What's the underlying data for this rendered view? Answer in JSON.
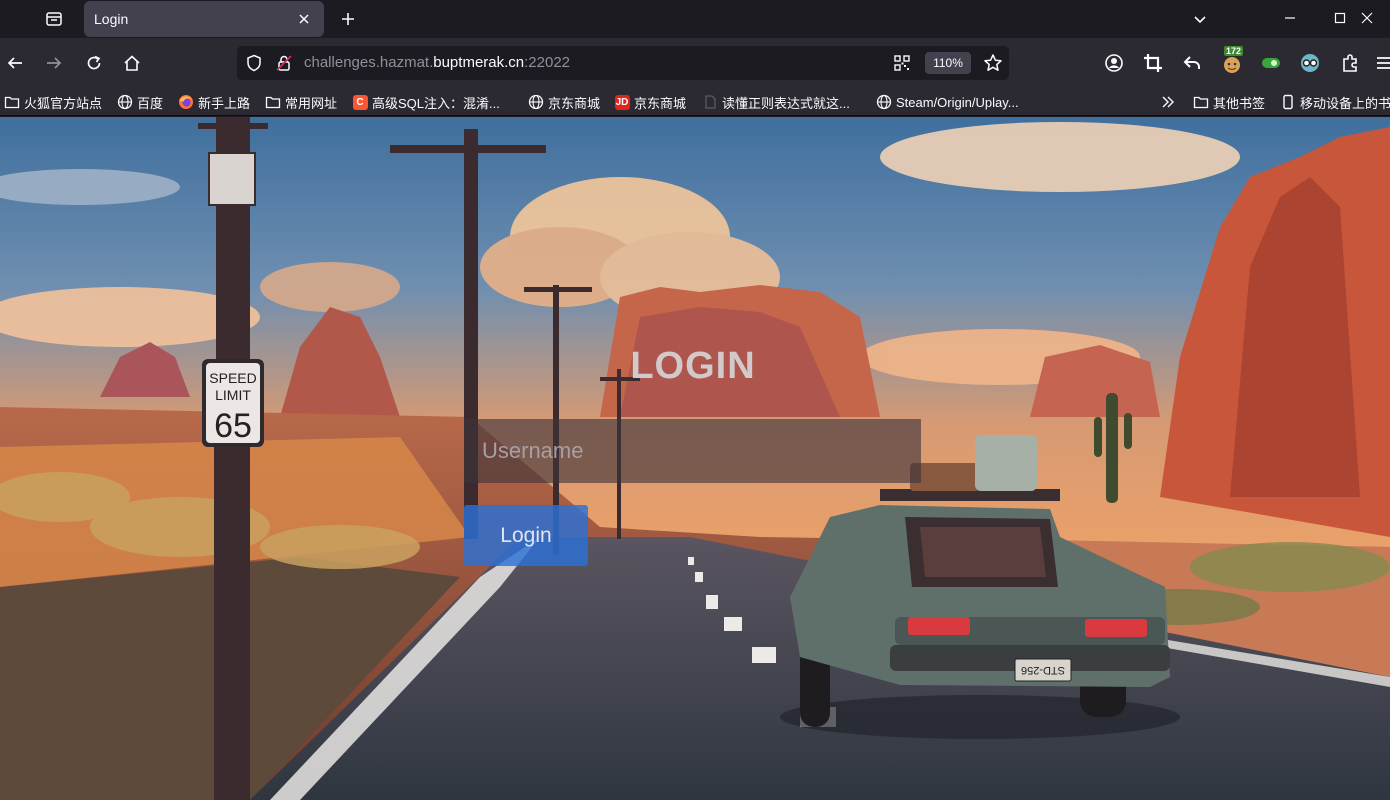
{
  "browser": {
    "tab": {
      "title": "Login"
    },
    "url": {
      "scheme_prefix": "challenges.hazmat.",
      "host": "buptmerak.cn",
      "port": ":22022"
    },
    "zoom": "110%",
    "extension_badge": "172"
  },
  "bookmarks": [
    {
      "label": "火狐官方站点",
      "icon": "folder-icon"
    },
    {
      "label": "百度",
      "icon": "globe-icon"
    },
    {
      "label": "新手上路",
      "icon": "firefox-icon"
    },
    {
      "label": "常用网址",
      "icon": "folder-icon"
    },
    {
      "label": "高级SQL注入：混淆...",
      "icon": "csdn-icon"
    },
    {
      "label": "京东商城",
      "icon": "globe-icon"
    },
    {
      "label": "京东商城",
      "icon": "jd-icon"
    },
    {
      "label": "读懂正则表达式就这...",
      "icon": "page-icon"
    },
    {
      "label": "Steam/Origin/Uplay...",
      "icon": "globe-icon"
    },
    {
      "label": "其他书签",
      "icon": "folder-icon"
    },
    {
      "label": "移动设备上的书签",
      "icon": "mobile-icon"
    }
  ],
  "page": {
    "heading": "LOGIN",
    "username_placeholder": "Username",
    "username_value": "",
    "login_button": "Login",
    "speed_sign": {
      "line1": "SPEED",
      "line2": "LIMIT",
      "value": "65"
    },
    "license_plate": "STD-256"
  },
  "colors": {
    "tab_bg": "#42414d",
    "toolbar_bg": "#2b2a33",
    "urlbar_bg": "#1c1b22",
    "login_button": "#2c70d6"
  }
}
